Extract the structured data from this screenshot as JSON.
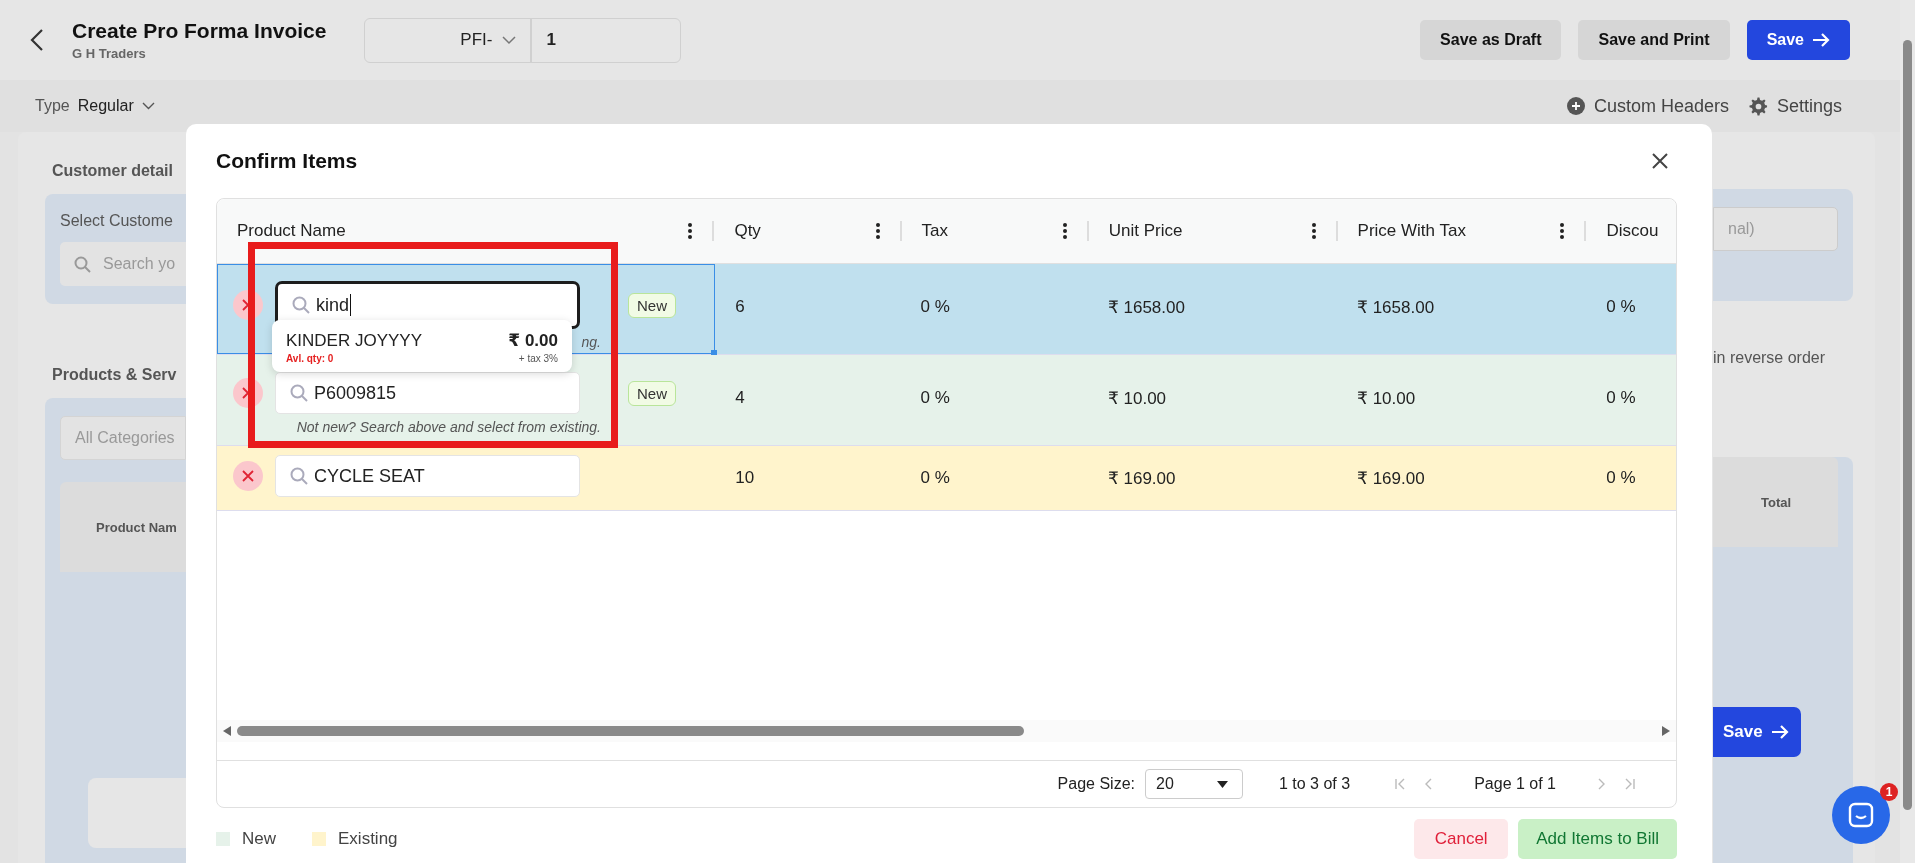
{
  "header": {
    "title": "Create Pro Forma Invoice",
    "subtitle": "G H Traders",
    "prefix": "PFI-",
    "number": "1",
    "buttons": [
      {
        "label": "Save as Draft",
        "kind": "secondary"
      },
      {
        "label": "Save and Print",
        "kind": "secondary"
      },
      {
        "label": "Save",
        "kind": "primary"
      }
    ]
  },
  "toolbar": {
    "type_label": "Type",
    "type_value": "Regular",
    "custom_headers": "Custom Headers",
    "settings": "Settings"
  },
  "background": {
    "customer_heading": "Customer detail",
    "select_customer": "Select Custome",
    "search_placeholder": "Search yo",
    "products_heading": "Products & Serv",
    "category_field": "All Categories",
    "product_column": "Product Nam",
    "notes_placeholder": "nal)",
    "reverse_order": "in reverse order",
    "total_column": "Total",
    "save_button": "Save",
    "chat_badge": "1"
  },
  "modal": {
    "title": "Confirm Items",
    "columns": [
      "Product Name",
      "Qty",
      "Tax",
      "Unit Price",
      "Price With Tax",
      "Discou"
    ],
    "rows": [
      {
        "kind": "new",
        "selected": true,
        "focused": true,
        "product": "kind",
        "badge": "New",
        "hint": "ng.",
        "qty": "6",
        "tax": "0 %",
        "unit_price": "₹ 1658.00",
        "price_with_tax": "₹ 1658.00",
        "discount": "0 %"
      },
      {
        "kind": "new",
        "selected": false,
        "focused": false,
        "product": "P6009815",
        "badge": "New",
        "hint": "Not new? Search above and select from existing.",
        "qty": "4",
        "tax": "0 %",
        "unit_price": "₹ 10.00",
        "price_with_tax": "₹ 10.00",
        "discount": "0 %"
      },
      {
        "kind": "existing",
        "selected": false,
        "focused": false,
        "product": "CYCLE SEAT",
        "qty": "10",
        "tax": "0 %",
        "unit_price": "₹ 169.00",
        "price_with_tax": "₹ 169.00",
        "discount": "0 %"
      }
    ],
    "suggestion": {
      "name": "KINDER JOYYYY",
      "price": "₹ 0.00",
      "stock": "Avl. qty: 0",
      "tax": "+ tax 3%"
    },
    "pagination": {
      "page_size_label": "Page Size:",
      "page_size": "20",
      "range": "1 to 3 of 3",
      "page": "Page 1 of 1"
    },
    "legend": [
      {
        "label": "New",
        "color": "#e6f2ea"
      },
      {
        "label": "Existing",
        "color": "#fff4cc"
      }
    ],
    "buttons": [
      {
        "label": "Cancel",
        "kind": "cancel"
      },
      {
        "label": "Add Items to Bill",
        "kind": "confirm"
      }
    ]
  }
}
